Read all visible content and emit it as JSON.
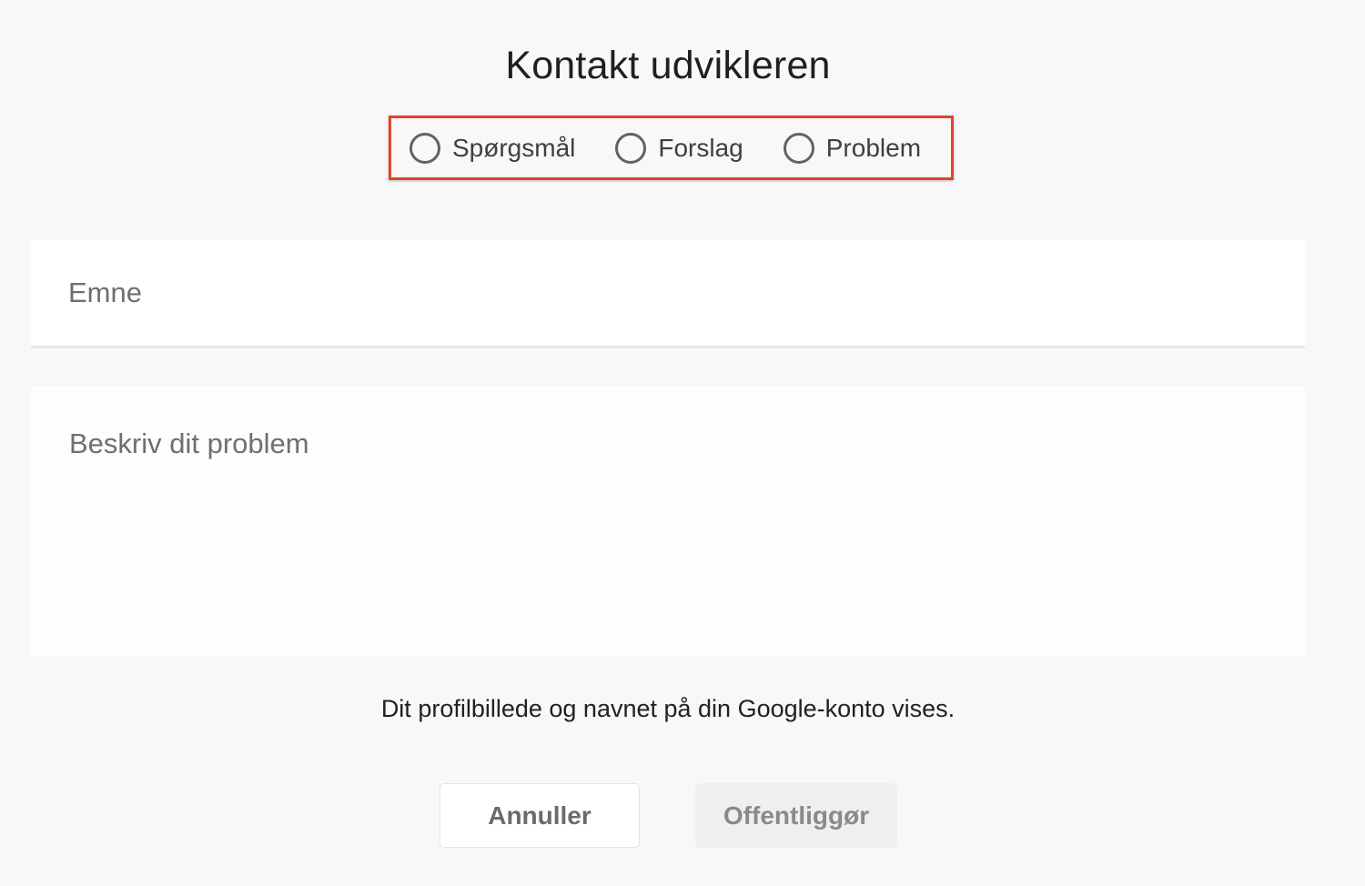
{
  "dialog": {
    "title": "Kontakt udvikleren"
  },
  "feedback_type": {
    "options": [
      {
        "label": "Spørgsmål",
        "selected": false
      },
      {
        "label": "Forslag",
        "selected": false
      },
      {
        "label": "Problem",
        "selected": false
      }
    ],
    "highlight_color": "#e2432a"
  },
  "subject": {
    "placeholder": "Emne",
    "value": ""
  },
  "description": {
    "placeholder": "Beskriv dit problem",
    "value": ""
  },
  "notice": "Dit profilbillede og navnet på din Google-konto vises.",
  "actions": {
    "cancel_label": "Annuller",
    "publish_label": "Offentliggør",
    "publish_enabled": false
  }
}
